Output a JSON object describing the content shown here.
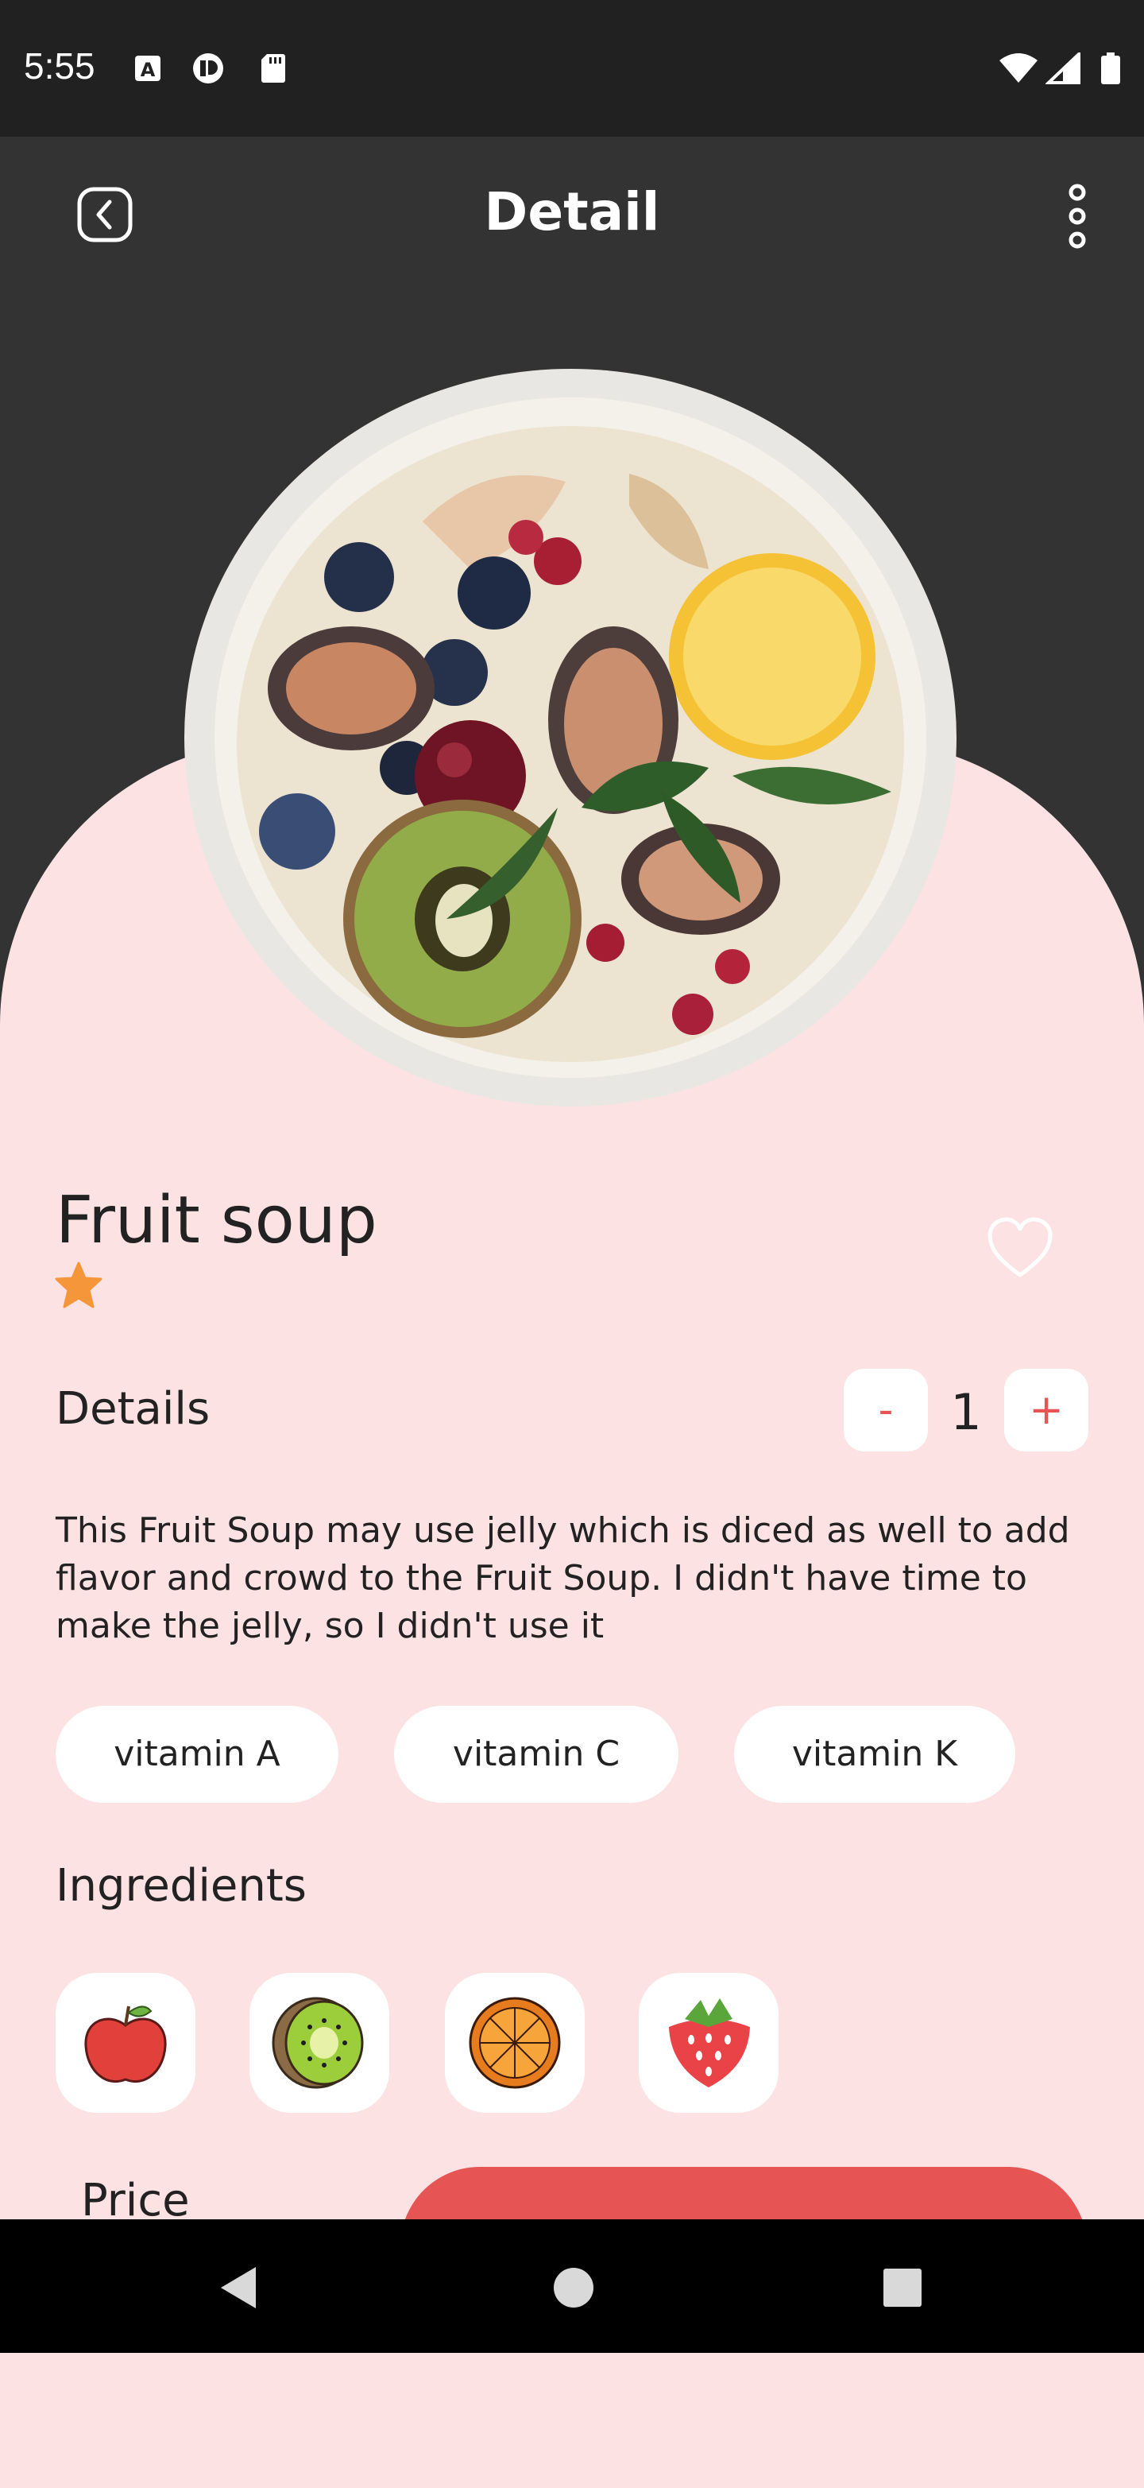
{
  "status_bar": {
    "time": "5:55",
    "left_icons": [
      "a-notification-icon",
      "app-notification-icon",
      "sd-card-icon"
    ],
    "right_icons": [
      "wifi-icon",
      "signal-icon",
      "battery-icon"
    ]
  },
  "header": {
    "title": "Detail",
    "back_icon": "chevron-left-icon",
    "menu_icon": "more-vertical-icon"
  },
  "product": {
    "name": "Fruit soup",
    "rating_stars": 1,
    "favorite_icon": "heart-outline-icon",
    "details_label": "Details",
    "quantity": {
      "decrement_label": "-",
      "value": "1",
      "increment_label": "+"
    },
    "description": "This Fruit Soup may use jelly which is diced as well to add flavor and crowd to the Fruit Soup. I didn't have time to make the jelly, so I didn't use it",
    "tags": [
      "vitamin A",
      "vitamin C",
      "vitamin K"
    ],
    "ingredients_label": "Ingredients",
    "ingredients": [
      "apple-icon",
      "kiwi-icon",
      "orange-icon",
      "strawberry-icon"
    ],
    "price_label": "Price"
  },
  "nav_bar": {
    "icons": [
      "back-triangle-icon",
      "home-circle-icon",
      "recents-square-icon"
    ]
  },
  "colors": {
    "background": "#fde2e3",
    "header": "#333333",
    "accent": "#e75454",
    "star": "#f5963a"
  }
}
